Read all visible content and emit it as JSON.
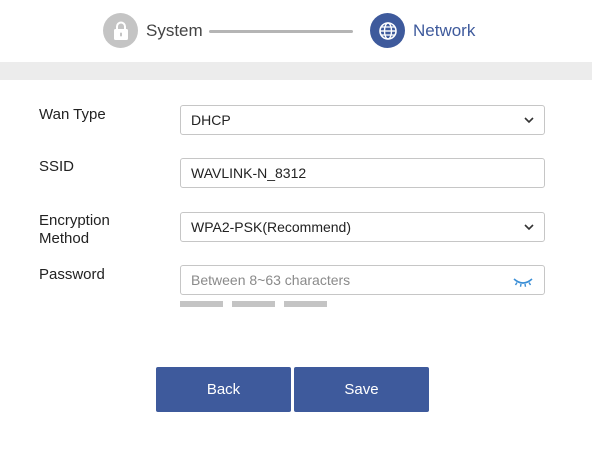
{
  "stepper": {
    "steps": [
      {
        "label": "System",
        "icon": "lock-icon",
        "state": "inactive"
      },
      {
        "label": "Network",
        "icon": "globe-icon",
        "state": "active"
      }
    ]
  },
  "form": {
    "wan_type": {
      "label": "Wan Type",
      "value": "DHCP"
    },
    "ssid": {
      "label": "SSID",
      "value": "WAVLINK-N_8312"
    },
    "encryption": {
      "label": "Encryption Method",
      "value": "WPA2-PSK(Recommend)"
    },
    "password": {
      "label": "Password",
      "value": "",
      "placeholder": "Between 8~63 characters",
      "toggle_icon": "eye-closed-icon",
      "strength_segments": 3,
      "strength_filled": 0
    }
  },
  "buttons": {
    "back": "Back",
    "save": "Save"
  },
  "colors": {
    "accent": "#3e5a9c",
    "inactive": "#c4c4c4",
    "band": "#ececec"
  }
}
